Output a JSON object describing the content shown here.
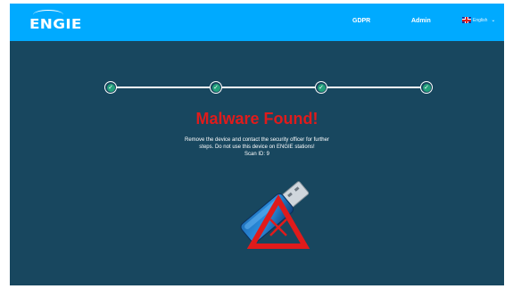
{
  "header": {
    "logo": "ENGIE",
    "nav": [
      "GDPR",
      "Admin"
    ],
    "language": "English"
  },
  "progress": {
    "steps_completed": 4,
    "steps_total": 4
  },
  "main": {
    "title": "Malware Found!",
    "message_lines": [
      "Remove the device and contact the security officer for further",
      "steps. Do not use this device on ENGIE stations!",
      "Scan ID: 9"
    ]
  },
  "colors": {
    "header": "#00aaff",
    "background": "#18475f",
    "alert": "#e01b1b",
    "step_done": "#22a07a"
  }
}
